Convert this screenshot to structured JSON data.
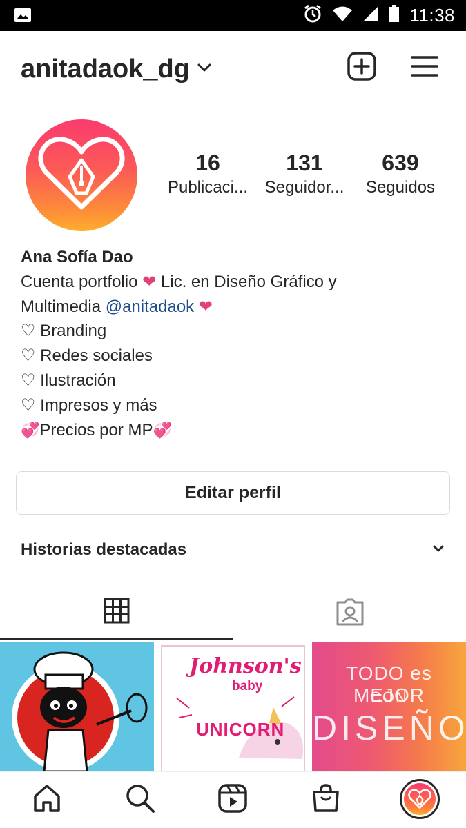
{
  "status_bar": {
    "time": "11:38",
    "icons": [
      "image-notification-icon",
      "alarm-icon",
      "wifi-icon",
      "signal-icon",
      "battery-icon"
    ]
  },
  "header": {
    "username": "anitadaok_dg",
    "icons": [
      "chevron-down-icon",
      "new-post-icon",
      "hamburger-menu-icon"
    ]
  },
  "profile": {
    "avatar_icon": "heart-pen-logo-icon",
    "stats": [
      {
        "value": "16",
        "label": "Publicaci..."
      },
      {
        "value": "131",
        "label": "Seguidor..."
      },
      {
        "value": "639",
        "label": "Seguidos"
      }
    ],
    "name": "Ana Sofía Dao",
    "bio": {
      "line1_text": "Cuenta portfolio",
      "line1_heart": "❤",
      "line1_rest": "Lic. en Diseño Gráfico y",
      "line2_text": "Multimedia",
      "line2_mention": "@anitadaok",
      "line2_heart": "❤",
      "list": [
        "♡ Branding",
        "♡ Redes sociales",
        "♡ Ilustración",
        "♡ Impresos y más"
      ],
      "pricing_text": "Precios por MP",
      "pricing_emoji": "💞"
    }
  },
  "actions": {
    "edit_profile": "Editar perfil"
  },
  "highlights": {
    "title": "Historias destacadas",
    "icon": "chevron-down-icon"
  },
  "tabs": [
    {
      "name": "grid",
      "icon": "grid-icon",
      "active": true
    },
    {
      "name": "tagged",
      "icon": "tagged-person-icon",
      "active": false
    }
  ],
  "posts": [
    {
      "description_icon": "chef-character-illustration"
    },
    {
      "brand": "Johnson's",
      "sub": "baby",
      "product": "UNICORN"
    },
    {
      "line1": "TODO es MEJOR",
      "line2": "CON",
      "line3": "DISEÑO"
    }
  ],
  "bottom_nav": {
    "icons": [
      "home-icon",
      "search-icon",
      "reels-icon",
      "shop-icon",
      "profile-avatar-icon"
    ]
  },
  "colors": {
    "accent_pink": "#e2407a",
    "mention_blue": "#1d4e89",
    "avatar_gradient_top": "#fb3b6e",
    "avatar_gradient_bottom": "#feae2c"
  }
}
